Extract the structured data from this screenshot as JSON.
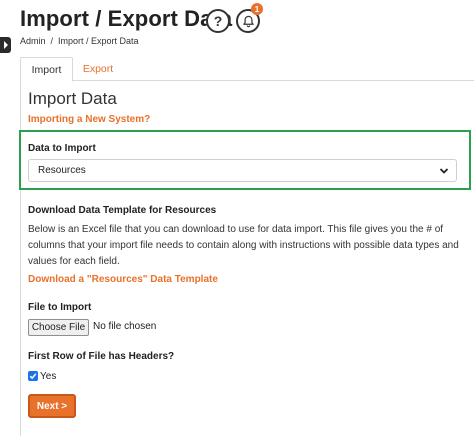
{
  "header": {
    "title": "Import / Export Data",
    "help_symbol": "?",
    "notification_count": "1"
  },
  "breadcrumb": {
    "items": [
      "Admin",
      "Import / Export Data"
    ],
    "separator": "/"
  },
  "tabs": [
    {
      "label": "Import",
      "active": true
    },
    {
      "label": "Export",
      "active": false
    }
  ],
  "main": {
    "section_title": "Import Data",
    "new_system_link": "Importing a New System?",
    "data_to_import": {
      "label": "Data to Import",
      "selected": "Resources"
    },
    "template": {
      "heading": "Download Data Template for Resources",
      "description": "Below is an Excel file that you can download to use for data import. This file gives you the # of columns that your import file needs to contain along with instructions with possible data types and values for each field.",
      "link": "Download a \"Resources\" Data Template"
    },
    "file": {
      "label": "File to Import",
      "button": "Choose File",
      "status": "No file chosen"
    },
    "headers": {
      "label": "First Row of File has Headers?",
      "checkbox_label": "Yes",
      "checked": true
    },
    "next_button": "Next >"
  },
  "colors": {
    "accent": "#e8712b",
    "highlight": "#2e9e4f",
    "checkbox": "#1a73e8"
  },
  "icons": {
    "sidebar_toggle": "chevron-right-icon",
    "help": "question-icon",
    "notifications": "bell-icon",
    "select_arrow": "chevron-down-icon"
  }
}
